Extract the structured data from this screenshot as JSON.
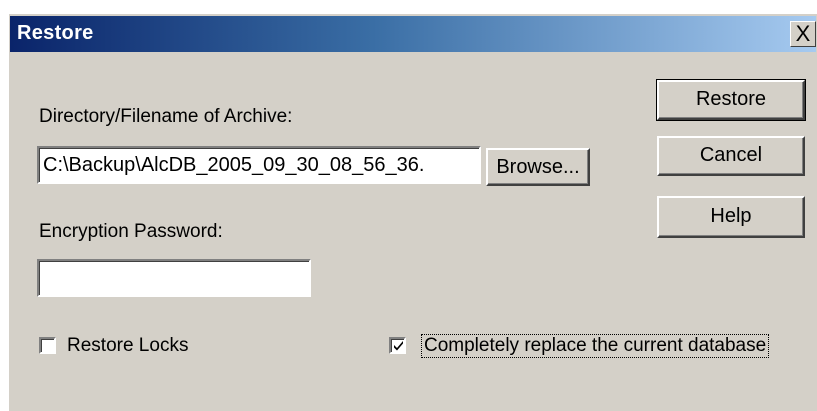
{
  "window": {
    "title": "Restore",
    "close_label": "X"
  },
  "form": {
    "archive_label": "Directory/Filename of Archive:",
    "archive_value": "C:\\Backup\\AlcDB_2005_09_30_08_56_36.",
    "browse_label": "Browse...",
    "password_label": "Encryption Password:",
    "password_value": ""
  },
  "buttons": {
    "restore": "Restore",
    "cancel": "Cancel",
    "help": "Help"
  },
  "options": {
    "restore_locks": {
      "label": "Restore Locks",
      "checked": false
    },
    "replace_db": {
      "label": "Completely replace the current database",
      "checked": true
    }
  },
  "colors": {
    "dialog_face": "#d4d0c8",
    "title_gradient_start": "#0a246a",
    "title_gradient_end": "#a6caf0"
  }
}
